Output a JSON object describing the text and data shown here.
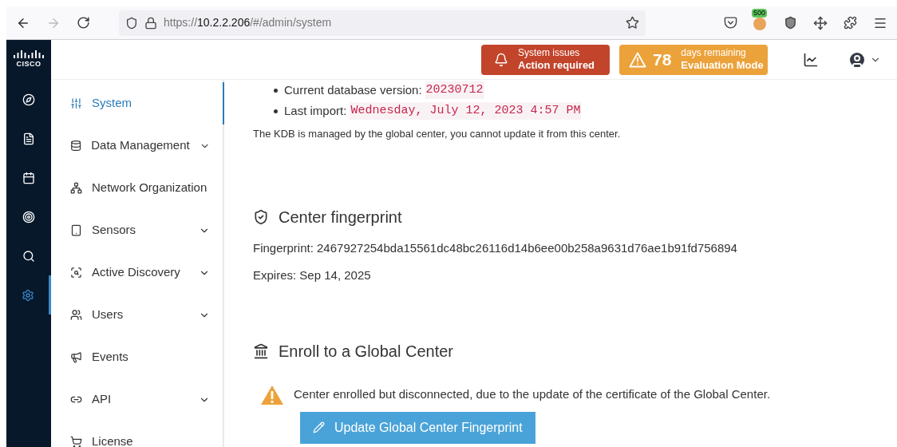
{
  "browser": {
    "url_host": "10.2.2.206",
    "url_prefix": "https://",
    "url_path": "/#/admin/system",
    "extension_badge": "500"
  },
  "logo": "CISCO",
  "header": {
    "issues": {
      "line1": "System issues",
      "line2": "Action required"
    },
    "evaluation": {
      "count": "78",
      "line1": "days remaining",
      "line2": "Evaluation Mode"
    }
  },
  "rail": [
    {
      "kind": "compass",
      "selected": false
    },
    {
      "kind": "document",
      "selected": false
    },
    {
      "kind": "calendar",
      "selected": false
    },
    {
      "kind": "target",
      "selected": false
    },
    {
      "kind": "search",
      "selected": false
    },
    {
      "kind": "settings",
      "selected": true
    }
  ],
  "sidebar": {
    "items": [
      {
        "label": "System",
        "selected": true,
        "expandable": false
      },
      {
        "label": "Data Management",
        "selected": false,
        "expandable": true
      },
      {
        "label": "Network Organization",
        "selected": false,
        "expandable": false
      },
      {
        "label": "Sensors",
        "selected": false,
        "expandable": true
      },
      {
        "label": "Active Discovery",
        "selected": false,
        "expandable": true
      },
      {
        "label": "Users",
        "selected": false,
        "expandable": true
      },
      {
        "label": "Events",
        "selected": false,
        "expandable": false
      },
      {
        "label": "API",
        "selected": false,
        "expandable": true
      },
      {
        "label": "License",
        "selected": false,
        "expandable": false
      }
    ]
  },
  "kdb": {
    "items": [
      {
        "label": "Current database version:",
        "value": "20230712"
      },
      {
        "label": "Last import:",
        "value": "Wednesday, July 12, 2023 4:57 PM"
      }
    ],
    "note": "The KDB is managed by the global center, you cannot update it from this center."
  },
  "fingerprint": {
    "title": "Center fingerprint",
    "fingerprint": "Fingerprint: 2467927254bda15561dc48bc26116d14b6ee00b258a9631d76ae1b91fd756894",
    "expires": "Expires: Sep 14, 2025"
  },
  "enroll": {
    "title": "Enroll to a Global Center",
    "warning": "Center enrolled but disconnected, due to the update of the certificate of the Global Center.",
    "button": "Update Global Center Fingerprint"
  }
}
